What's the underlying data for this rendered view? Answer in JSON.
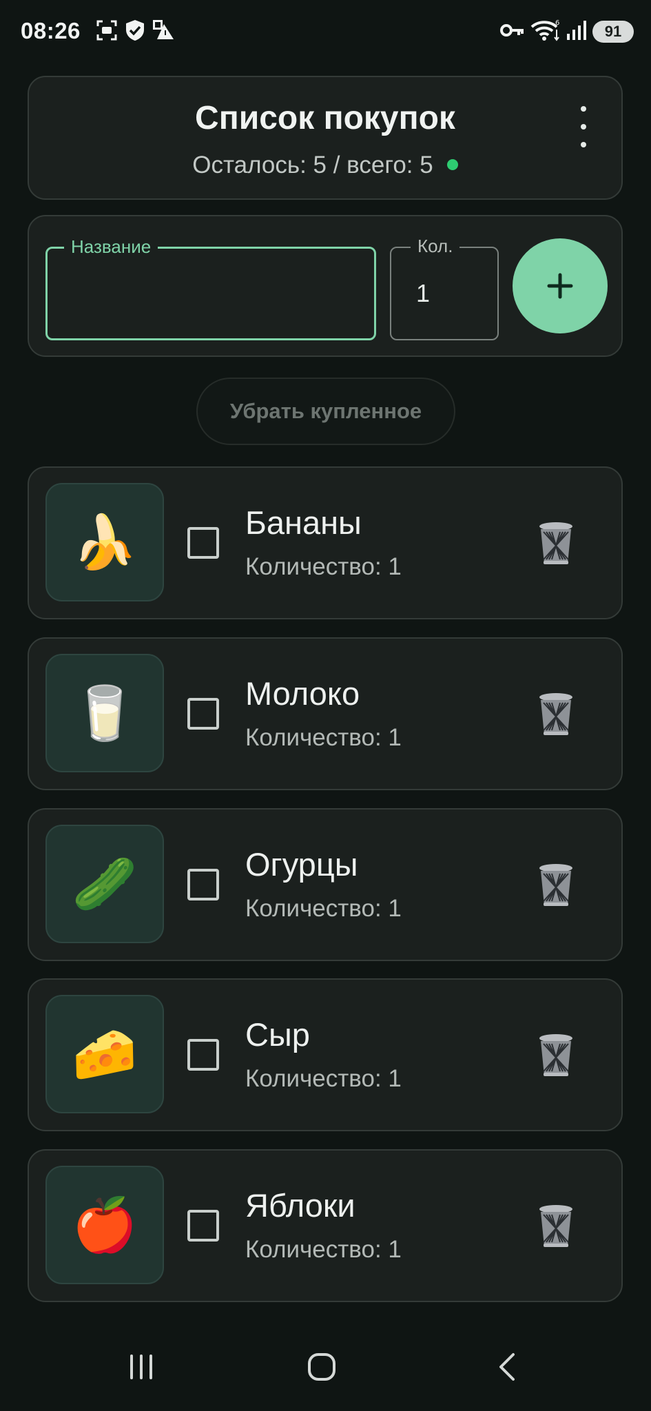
{
  "status_bar": {
    "time": "08:26",
    "battery": "91",
    "icons": [
      "screenshot-icon",
      "shield-check-icon",
      "notification-icon",
      "key-icon",
      "wifi-icon",
      "signal-icon"
    ]
  },
  "header": {
    "title": "Список покупок",
    "subtitle": "Осталось: 5 / всего: 5",
    "status_color": "#2ecc71"
  },
  "input": {
    "name_label": "Название",
    "name_value": "",
    "qty_label": "Кол.",
    "qty_value": "1",
    "accent_color": "#7fd3a8"
  },
  "clear_button": {
    "label": "Убрать купленное"
  },
  "items": [
    {
      "emoji": "🍌",
      "name": "Бананы",
      "qty": "Количество: 1",
      "checked": false
    },
    {
      "emoji": "🥛",
      "name": "Молоко",
      "qty": "Количество: 1",
      "checked": false
    },
    {
      "emoji": "🥒",
      "name": "Огурцы",
      "qty": "Количество: 1",
      "checked": false
    },
    {
      "emoji": "🧀",
      "name": "Сыр",
      "qty": "Количество: 1",
      "checked": false
    },
    {
      "emoji": "🍎",
      "name": "Яблоки",
      "qty": "Количество: 1",
      "checked": false
    }
  ],
  "nav": {
    "icons": [
      "recent-apps-icon",
      "home-icon",
      "back-icon"
    ]
  }
}
